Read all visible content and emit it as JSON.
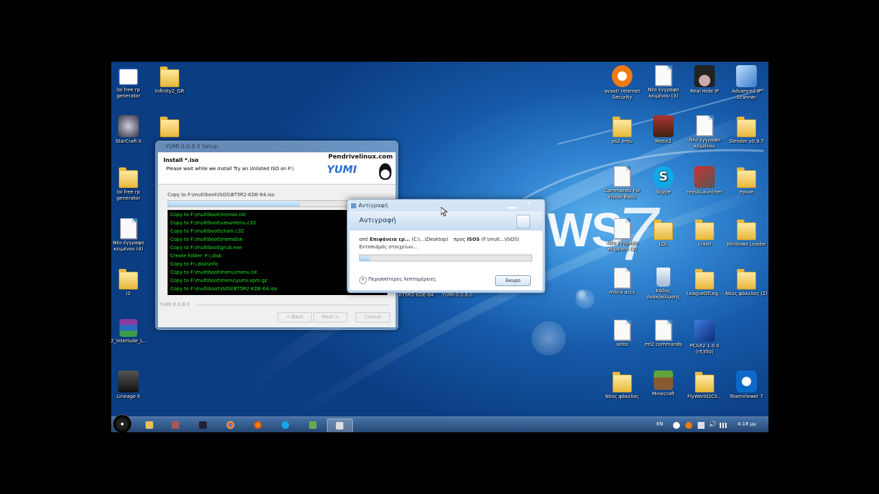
{
  "desktop_icons": {
    "lol_free_rp_1": "lol free rp generator",
    "infinity2": "Infinity2_GR",
    "starcraft": "StarCraft II",
    "lol_free_rp_2": "lol free rp generator",
    "neo_keimeno_4": "Νέο έγγραφο κειμένου (4)",
    "i2": "i2",
    "interlude": "i2_Interlude_L...",
    "lineage": "Lineage II",
    "avast": "avast! Internet Security",
    "neo_keimeno_3": "Νέο έγγραφο κειμένου (3)",
    "real_hide_ip": "Real Hide IP",
    "advanced_ip": "Advanced IP Scanner",
    "ps2emu": "ps2 emu",
    "metin2": "Metin2",
    "neo_keimeno_2": "Νέο έγγραφο κειμένου",
    "slender": "Slender v0.9.7",
    "commands": "Commands For Visual Basic",
    "skype": "Skype",
    "redsk": "redskLauncher",
    "epsxe": "epsxe",
    "neo_keimeno_1": "Νέο έγγραφο κειμένου (2)",
    "lol": "LOL",
    "crash": "crash",
    "windows_loader": "Windows Loader",
    "mikra_accs": "mikra accs",
    "recycle": "Κάδος Ανακύκλωσης",
    "leagueoflegends": "LeagueOfLeg...",
    "neos_fakelos_2": "Νέος φάκελος (2)",
    "sinto": "sinto",
    "mt2_commands": "mt2 commands",
    "pcsx2": "PCSX2 1.0.0 (r5350)",
    "neos_fakelos": "Νέος φάκελος",
    "minecraft": "Minecraft",
    "flyworld": "FlyWorld2Cli...",
    "teamviewer": "TeamViewer 7",
    "bt5r2": "BT5R2-KDE-64",
    "yumi_exe": "YUMI-0.0.8.0"
  },
  "wallpaper": {
    "text_ws": "WS",
    "text_7": "7"
  },
  "yumi_window": {
    "title": "YUMI 0.0.8.0 Setup",
    "header_title": "Install *.iso",
    "header_subtitle": "Please wait while we Install Try an Unlisted ISO on F:\\",
    "logo_text": "Pendrivelinux.com",
    "logo_name": "YUMI",
    "status": "Copy to F:\\multiboot\\ISOS\\BT5R2-KDE-64.iso",
    "progress": 0.6,
    "log_lines": [
      "Copy to F:\\multiboot\\license.txt",
      "Copy to F:\\multiboot\\vesamenu.c32",
      "Copy to F:\\multiboot\\chain.c32",
      "Copy to F:\\multiboot\\memdisk",
      "Copy to F:\\multiboot\\grub.exe",
      "Create folder: F:\\.disk",
      "Copy to F:\\.disk\\info",
      "Copy to F:\\multiboot\\menu\\menu.lst",
      "Copy to F:\\multiboot\\menu\\yumi.xpm.gz",
      "Copy to F:\\multiboot\\ISOS\\BT5R2-KDE-64.iso"
    ],
    "version": "YUMI 0.0.8.0",
    "back_label": "< Back",
    "next_label": "Next >",
    "cancel_label": "Cancel"
  },
  "copy_dialog": {
    "title": "Αντιγραφή",
    "heading": "Αντιγραφή",
    "from_label": "από",
    "from_bold": "Επιφάνεια ερ...",
    "from_path": "(C:\\...\\Desktop)",
    "to_label": "προς",
    "to_bold": "ISOS",
    "to_path": "(F:\\mult...\\ISOS)",
    "status": "Εντοπισμός στοιχείων...",
    "progress": 0.06,
    "more_details": "Περισσότερες λεπτομέρειες",
    "cancel": "Άκυρο"
  },
  "taskbar": {
    "language": "EN",
    "time": "4:18 μμ"
  },
  "colors": {
    "log_text": "#23e823",
    "wallpaper": "#1559a8"
  }
}
